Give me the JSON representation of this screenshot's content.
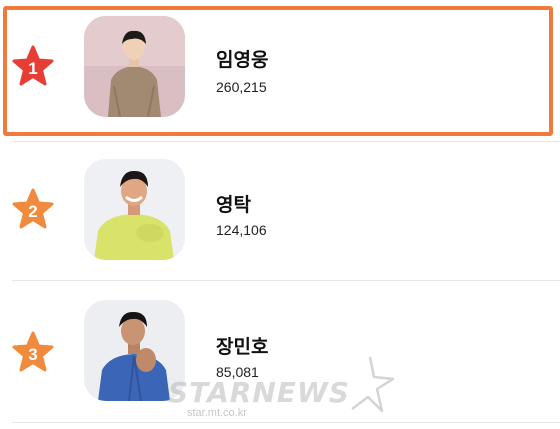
{
  "ranking": [
    {
      "rank": "1",
      "name": "임영웅",
      "votes": "260,215",
      "highlighted": true,
      "badge_color": "#e63e35"
    },
    {
      "rank": "2",
      "name": "영탁",
      "votes": "124,106",
      "highlighted": false,
      "badge_color": "#f08a3c"
    },
    {
      "rank": "3",
      "name": "장민호",
      "votes": "85,081",
      "highlighted": false,
      "badge_color": "#f08a3c"
    }
  ],
  "watermark": {
    "text": "STARNEWS",
    "url": "star.mt.co.kr"
  },
  "colors": {
    "highlight_border": "#ee7b3c",
    "divider": "#e6e6e6"
  }
}
